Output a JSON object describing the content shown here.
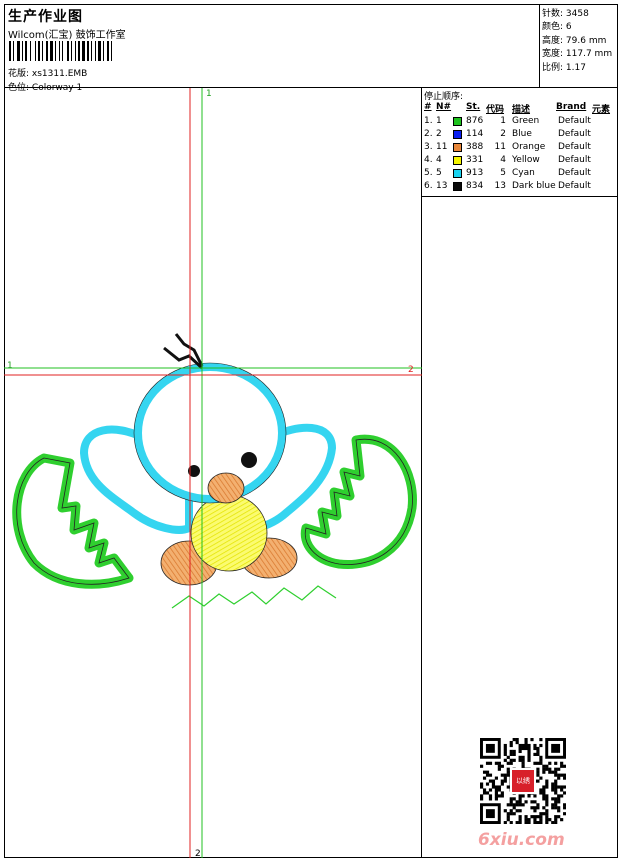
{
  "header": {
    "title": "生产作业图",
    "company": "Wilcom(汇宝) 鼓饰工作室",
    "design_label": "花版:",
    "design_value": "xs1311.EMB",
    "colorway_label": "色位:",
    "colorway_value": "Colorway 1"
  },
  "stats": [
    {
      "label": "针数:",
      "value": "3458"
    },
    {
      "label": "颜色:",
      "value": "6"
    },
    {
      "label": "高度:",
      "value": "79.6 mm"
    },
    {
      "label": "宽度:",
      "value": "117.7 mm"
    },
    {
      "label": "比例:",
      "value": "1.17"
    }
  ],
  "stop_sequence": {
    "title": "停止顺序:",
    "headers": [
      "#",
      "N#",
      "St.",
      "代码",
      "描述",
      "Brand",
      "元素"
    ],
    "rows": [
      {
        "num": "1.",
        "n": "1",
        "st": "876",
        "code": "1",
        "desc": "Green",
        "brand": "Default",
        "color": "#1ec31e"
      },
      {
        "num": "2.",
        "n": "2",
        "st": "114",
        "code": "2",
        "desc": "Blue",
        "brand": "Default",
        "color": "#0a1ef0"
      },
      {
        "num": "3.",
        "n": "11",
        "st": "388",
        "code": "11",
        "desc": "Orange",
        "brand": "Default",
        "color": "#e8873a"
      },
      {
        "num": "4.",
        "n": "4",
        "st": "331",
        "code": "4",
        "desc": "Yellow",
        "brand": "Default",
        "color": "#f5f500"
      },
      {
        "num": "5.",
        "n": "5",
        "st": "913",
        "code": "5",
        "desc": "Cyan",
        "brand": "Default",
        "color": "#19d3f0"
      },
      {
        "num": "6.",
        "n": "13",
        "st": "834",
        "code": "13",
        "desc": "Dark blue",
        "brand": "Default",
        "color": "#0a0a0a"
      }
    ]
  },
  "guides": {
    "v_label_top": "1",
    "v_label_bottom": "2",
    "h_label_left": "1",
    "h_label_right": "2"
  },
  "seal_text": "以绣",
  "watermark": "6xiu.com"
}
